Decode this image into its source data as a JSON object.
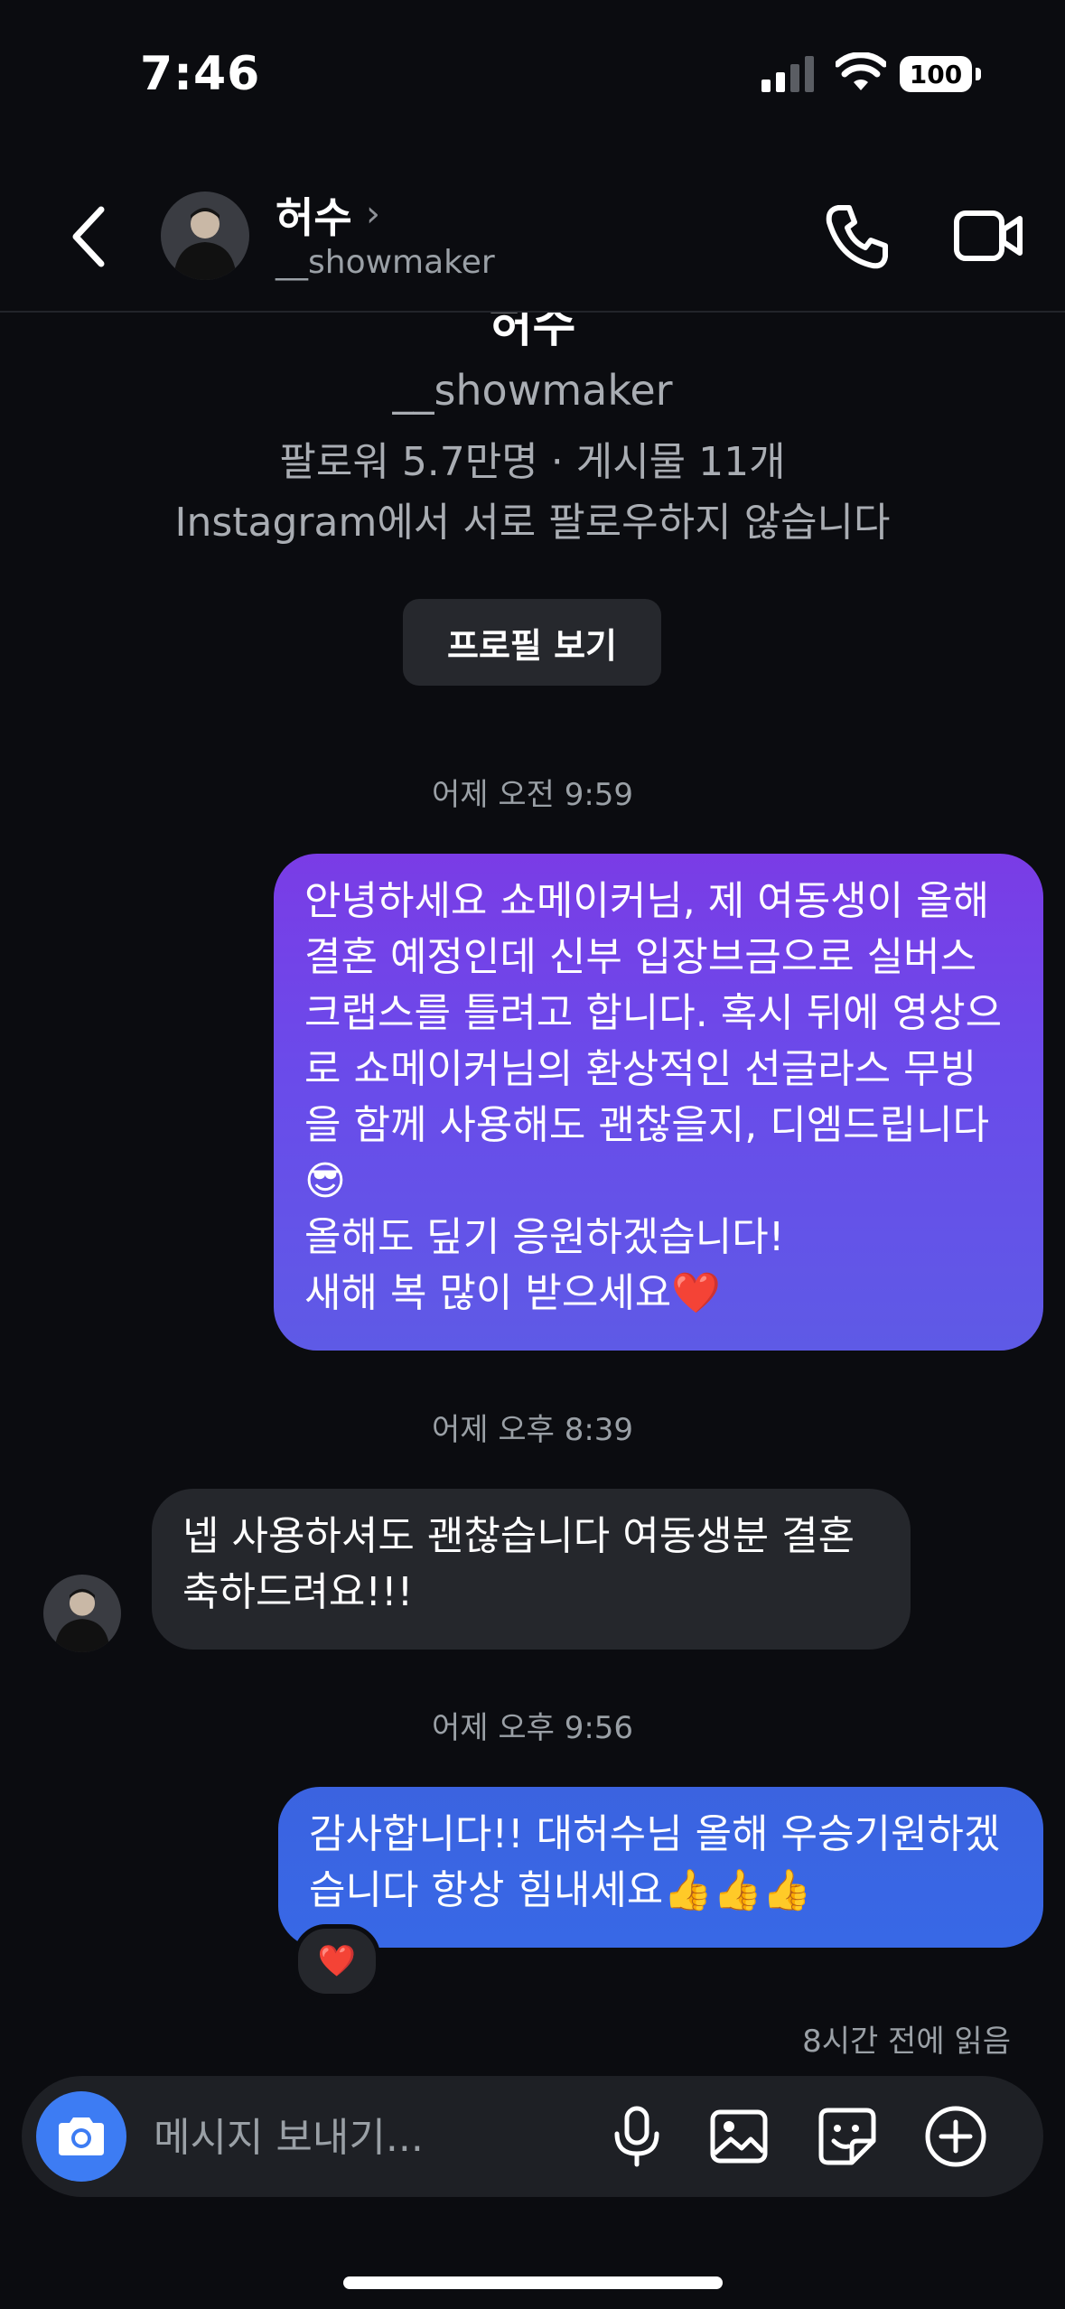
{
  "status_bar": {
    "time": "7:46",
    "battery": "100"
  },
  "header": {
    "name": "허수",
    "chevron": "›",
    "handle": "__showmaker"
  },
  "profile": {
    "name_partial": "허수",
    "handle": "__showmaker",
    "stats": "팔로워 5.7만명 · 게시물 11개",
    "mutual": "Instagram에서 서로 팔로우하지 않습니다",
    "view_profile_label": "프로필 보기"
  },
  "messages": [
    {
      "timestamp": "어제 오전 9:59",
      "sender": "me",
      "text": "안녕하세요 쇼메이커님, 제 여동생이 올해\n결혼 예정인데 신부 입장브금으로 실버스\n크랩스를 틀려고 합니다. 혹시 뒤에 영상으\n로 쇼메이커님의 환상적인 선글라스 무빙\n을 함께 사용해도 괜찮을지, 디엠드립니다\n😎\n올해도 딮기 응원하겠습니다!\n새해 복 많이 받으세요❤️"
    },
    {
      "timestamp": "어제 오후 8:39",
      "sender": "them",
      "text": "넵 사용하셔도 괜찮습니다 여동생분 결혼\n축하드려요!!!"
    },
    {
      "timestamp": "어제 오후 9:56",
      "sender": "me",
      "text": "감사합니다!! 대허수님 올해 우승기원하겠\n습니다 항상 힘내세요👍👍👍",
      "reaction": "❤️"
    }
  ],
  "read_receipt": "8시간 전에 읽음",
  "composer": {
    "placeholder": "메시지 보내기..."
  },
  "icons": [
    "back-arrow-icon",
    "phone-icon",
    "video-camera-icon",
    "camera-icon",
    "microphone-icon",
    "gallery-icon",
    "sticker-icon",
    "plus-circle-icon"
  ],
  "colors": {
    "accent": "#3d7cf3",
    "bubble_gradient_top": "#7a3ce6",
    "bubble_blue": "#3868e6",
    "bubble_incoming": "#25272c"
  }
}
